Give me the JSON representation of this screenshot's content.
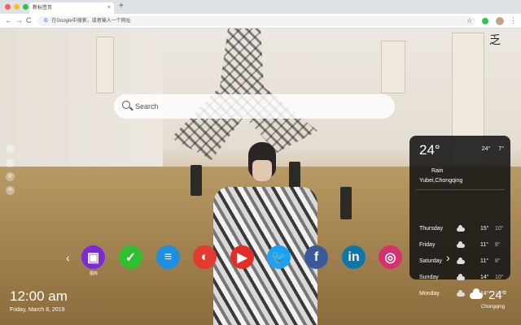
{
  "browser": {
    "traffic_colors": [
      "#ff5f57",
      "#febc2e",
      "#28c840"
    ],
    "tab_title": "新标签页",
    "tab_close": "×",
    "new_tab": "+",
    "nav_back": "←",
    "nav_forward": "→",
    "nav_reload": "C",
    "omnibox_placeholder": "在Google中搜索，或者输入一个网址",
    "star": "☆",
    "menu": "⋮"
  },
  "page": {
    "logo_mark": "乏",
    "search_placeholder": "Search",
    "social": [
      "f",
      "t",
      "p",
      "in"
    ],
    "weather": {
      "current_temp": "24°",
      "high": "24°",
      "low": "7°",
      "condition": "Rain",
      "location": "Yubei,Chongqing",
      "forecast": [
        {
          "day": "Thursday",
          "hi": "15°",
          "lo": "10°"
        },
        {
          "day": "Friday",
          "hi": "11°",
          "lo": "8°"
        },
        {
          "day": "Saturday",
          "hi": "11°",
          "lo": "8°"
        },
        {
          "day": "Sunday",
          "hi": "14°",
          "lo": "10°"
        },
        {
          "day": "Monday",
          "hi": "14°",
          "lo": "10°"
        }
      ]
    },
    "dock": {
      "arrow_left": "‹",
      "arrow_right": "›",
      "apps": [
        {
          "name": "photos",
          "label": "图库",
          "color": "#7b2bd6",
          "glyph": "▣"
        },
        {
          "name": "tasks",
          "label": "",
          "color": "#2fbf2f",
          "glyph": "✓"
        },
        {
          "name": "notes",
          "label": "",
          "color": "#1e8fe0",
          "glyph": "≡"
        },
        {
          "name": "chrome",
          "label": "",
          "color": "#e53a2f",
          "glyph": "◐"
        },
        {
          "name": "youtube",
          "label": "",
          "color": "#e52d27",
          "glyph": "▶"
        },
        {
          "name": "twitter",
          "label": "",
          "color": "#1da1f2",
          "glyph": "🐦"
        },
        {
          "name": "facebook",
          "label": "",
          "color": "#3b5998",
          "glyph": "f"
        },
        {
          "name": "linkedin",
          "label": "",
          "color": "#0e76a8",
          "glyph": "in"
        },
        {
          "name": "instagram",
          "label": "",
          "color": "#d6306f",
          "glyph": "◎"
        }
      ]
    },
    "clock": "12:00 am",
    "date": "Friday, March 8, 2019",
    "mini_weather": {
      "temp": "24°",
      "city": "Chongqing"
    }
  }
}
